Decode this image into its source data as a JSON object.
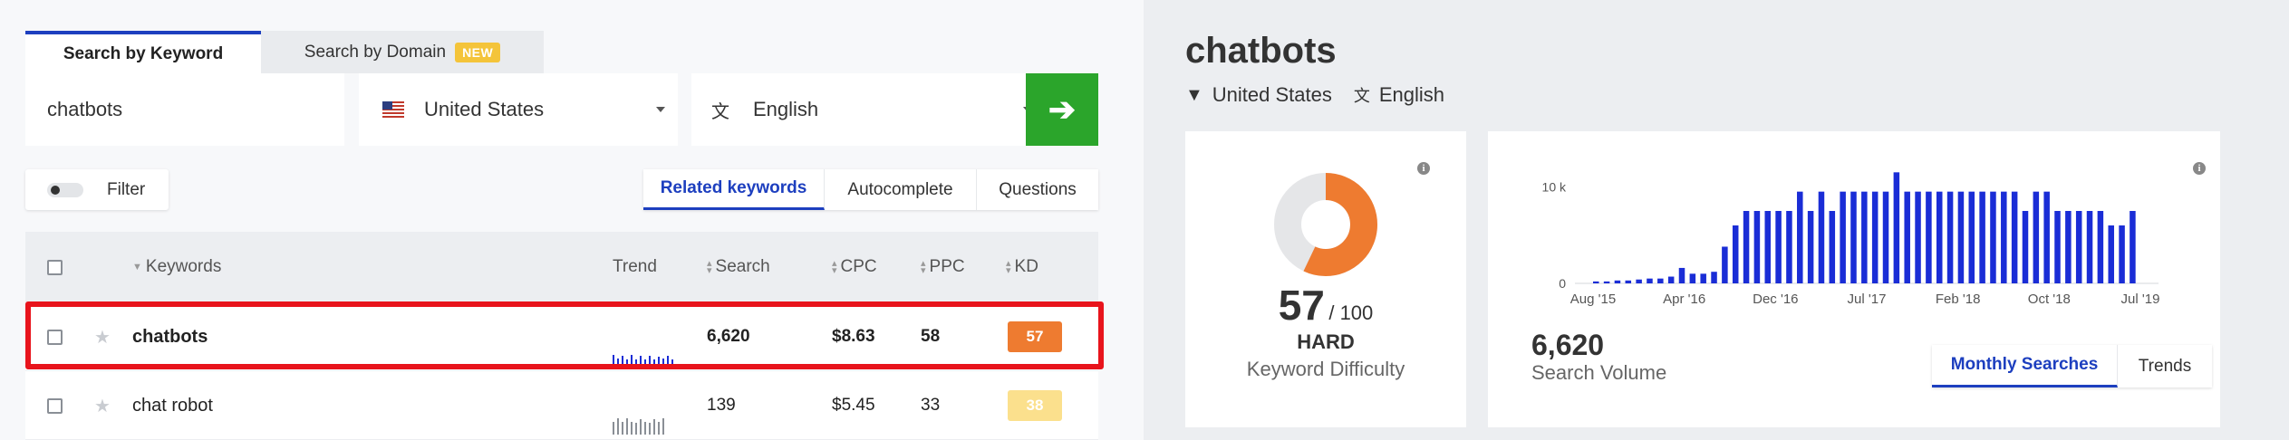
{
  "search": {
    "tabs": [
      {
        "label": "Search by Keyword"
      },
      {
        "label": "Search by Domain",
        "badge": "NEW"
      }
    ],
    "query": "chatbots",
    "location": "United States",
    "language": "English",
    "go_icon": "arrow-right-icon"
  },
  "toolbar": {
    "filter_label": "Filter",
    "keyword_tabs": [
      "Related keywords",
      "Autocomplete",
      "Questions"
    ]
  },
  "table": {
    "columns": [
      "Keywords",
      "Trend",
      "Search",
      "CPC",
      "PPC",
      "KD"
    ],
    "rows": [
      {
        "keyword": "chatbots",
        "search": "6,620",
        "cpc": "$8.63",
        "ppc": "58",
        "kd": "57",
        "kd_color": "#ee7b30",
        "trend": [
          0.5,
          0.35,
          0.45,
          0.3,
          0.5,
          0.3,
          0.45,
          0.3,
          0.45,
          0.3,
          0.4,
          0.35,
          0.45,
          0.3
        ]
      },
      {
        "keyword": "chat robot",
        "search": "139",
        "cpc": "$5.45",
        "ppc": "33",
        "kd": "38",
        "kd_color": "#fbe08d",
        "trend": [
          0.6,
          0.75,
          0.6,
          0.75,
          0.6,
          0.55,
          0.7,
          0.6,
          0.55,
          0.7,
          0.6,
          0.75
        ]
      }
    ]
  },
  "detail": {
    "keyword": "chatbots",
    "location": "United States",
    "language": "English",
    "kd_value": "57",
    "kd_max": "/ 100",
    "kd_level": "HARD",
    "kd_label": "Keyword Difficulty",
    "kd_color": "#ee7b30",
    "search_volume": "6,620",
    "search_volume_label": "Search Volume",
    "chart_tabs": [
      "Monthly Searches",
      "Trends"
    ]
  },
  "chart_data": {
    "type": "bar",
    "ytick_labels": [
      "0",
      "10 k"
    ],
    "yticks": [
      0,
      10000
    ],
    "xtick_labels": [
      "Aug '15",
      "Apr '16",
      "Dec '16",
      "Jul '17",
      "Feb '18",
      "Oct '18",
      "Jul '19"
    ],
    "ylim": [
      0,
      12000
    ],
    "values": [
      200,
      200,
      300,
      300,
      400,
      500,
      500,
      700,
      1600,
      1000,
      1000,
      1200,
      3800,
      6000,
      7500,
      7500,
      7500,
      7500,
      7500,
      9500,
      7500,
      9500,
      7500,
      9500,
      9500,
      9500,
      9500,
      9500,
      11500,
      9500,
      9500,
      9500,
      9500,
      9500,
      9500,
      9500,
      9500,
      9500,
      9500,
      9500,
      7500,
      9500,
      9500,
      7500,
      7500,
      7500,
      7500,
      7500,
      6000,
      6000,
      7500
    ],
    "bar_color": "#1a2dd6"
  }
}
